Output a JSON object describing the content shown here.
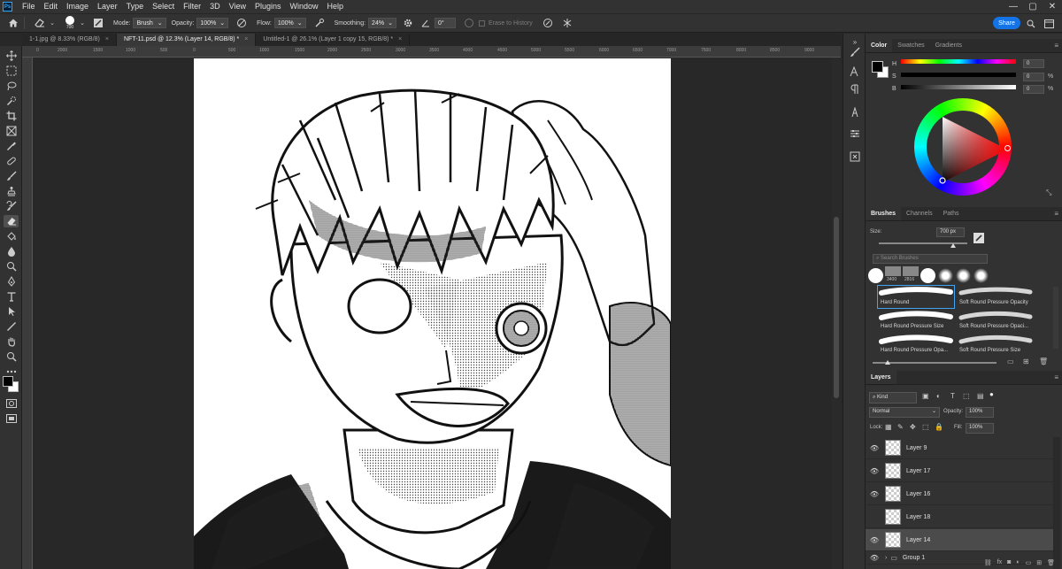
{
  "app": {
    "logo": "Ps"
  },
  "menu": [
    "File",
    "Edit",
    "Image",
    "Layer",
    "Type",
    "Select",
    "Filter",
    "3D",
    "View",
    "Plugins",
    "Window",
    "Help"
  ],
  "window_controls": [
    "—",
    "▢",
    "✕"
  ],
  "options": {
    "brush_size": "700",
    "mode_label": "Mode:",
    "mode_value": "Brush",
    "opacity_label": "Opacity:",
    "opacity_value": "100%",
    "flow_label": "Flow:",
    "flow_value": "100%",
    "smoothing_label": "Smoothing:",
    "smoothing_value": "24%",
    "angle_value": "0°",
    "erase_history": "Erase to History",
    "share": "Share"
  },
  "tabs": [
    {
      "label": "1-1.jpg @ 8.33% (RGB/8)",
      "close": "×",
      "active": false
    },
    {
      "label": "NFT-11.psd @ 12.3% (Layer 14, RGB/8) *",
      "close": "×",
      "active": true
    },
    {
      "label": "Untitled-1 @ 26.1% (Layer 1 copy 15, RGB/8) *",
      "close": "×",
      "active": false
    }
  ],
  "ruler_ticks": [
    "0",
    "2000",
    "1500",
    "1000",
    "500",
    "0",
    "500",
    "1000",
    "1500",
    "2000",
    "2500",
    "3000",
    "3500",
    "4000",
    "4500",
    "5000",
    "5500",
    "6000",
    "6500",
    "7000",
    "7500",
    "8000",
    "8500",
    "9000"
  ],
  "color_panel": {
    "tabs": [
      "Color",
      "Swatches",
      "Gradients"
    ],
    "sliders": [
      {
        "letter": "H",
        "value": "0",
        "unit": ""
      },
      {
        "letter": "S",
        "value": "0",
        "unit": "%"
      },
      {
        "letter": "B",
        "value": "0",
        "unit": "%"
      }
    ],
    "colors": {
      "foreground": "#000000",
      "background": "#ffffff",
      "wheel_hue": "#ff0000"
    }
  },
  "brushes_panel": {
    "tabs": [
      "Brushes",
      "Channels",
      "Paths"
    ],
    "size_label": "Size:",
    "size_value": "700 px",
    "search_placeholder": "Search Brushes",
    "recent": [
      "3400",
      "2816"
    ],
    "presets": [
      "Hard Round",
      "Soft Round Pressure Opacity",
      "Hard Round Pressure Size",
      "Soft Round Pressure Opaci...",
      "Hard Round Pressure Opa...",
      "Soft Round Pressure Size"
    ],
    "selected_preset": "Hard Round"
  },
  "layers_panel": {
    "title": "Layers",
    "kind": "Kind",
    "blend_mode": "Normal",
    "opacity_label": "Opacity:",
    "opacity_value": "100%",
    "lock_label": "Lock:",
    "fill_label": "Fill:",
    "fill_value": "100%",
    "layers": [
      {
        "name": "Layer 9",
        "visible": true,
        "selected": false
      },
      {
        "name": "Layer 17",
        "visible": true,
        "selected": false
      },
      {
        "name": "Layer 16",
        "visible": true,
        "selected": false
      },
      {
        "name": "Layer 18",
        "visible": false,
        "selected": false
      },
      {
        "name": "Layer 14",
        "visible": true,
        "selected": true
      },
      {
        "name": "Group 1",
        "visible": true,
        "selected": false
      }
    ]
  }
}
